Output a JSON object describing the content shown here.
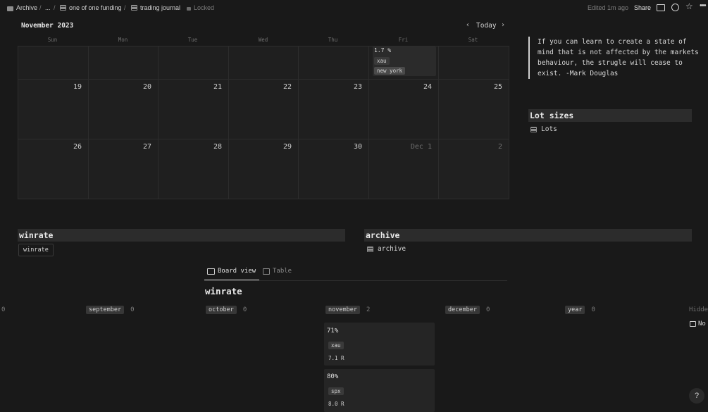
{
  "topbar": {
    "crumbs": [
      "Archive",
      "...",
      "one of one funding",
      "trading journal"
    ],
    "locked": "Locked",
    "edited": "Edited 1m ago",
    "share": "Share",
    "icons": [
      "comment-icon",
      "history-icon",
      "star-icon",
      "more-icon"
    ]
  },
  "calendar": {
    "month": "November 2023",
    "today": "Today",
    "weekdays": [
      "Sun",
      "Mon",
      "Tue",
      "Wed",
      "Thu",
      "Fri",
      "Sat"
    ],
    "row2": [
      "19",
      "20",
      "21",
      "22",
      "23",
      "24",
      "25"
    ],
    "row3": [
      "26",
      "27",
      "28",
      "29",
      "30",
      "Dec 1",
      "2"
    ],
    "event": {
      "value": "1.7 %",
      "asset": "xau",
      "session": "new york"
    }
  },
  "quote": "If you can learn to create a state of mind that is not affected by the markets behaviour, the strugle will cease to exist. -Mark Douglas",
  "lot_sizes": {
    "heading": "Lot sizes",
    "link": "Lots"
  },
  "winrate_block": {
    "heading": "winrate",
    "button": "winrate"
  },
  "archive_block": {
    "heading": "archive",
    "link": "archive"
  },
  "board": {
    "tabs": [
      "Board view",
      "Table"
    ],
    "title": "winrate",
    "left_count": "0",
    "columns": [
      {
        "label": "september",
        "count": "0"
      },
      {
        "label": "october",
        "count": "0"
      },
      {
        "label": "november",
        "count": "2"
      },
      {
        "label": "december",
        "count": "0"
      },
      {
        "label": "year",
        "count": "0"
      }
    ],
    "hidden": "Hidde",
    "no_label": "No",
    "cards": [
      {
        "value": "71%",
        "asset": "xau",
        "r": "7.1 R"
      },
      {
        "value": "80%",
        "asset": "spx",
        "r": "8.0 R"
      }
    ]
  },
  "help": "?"
}
